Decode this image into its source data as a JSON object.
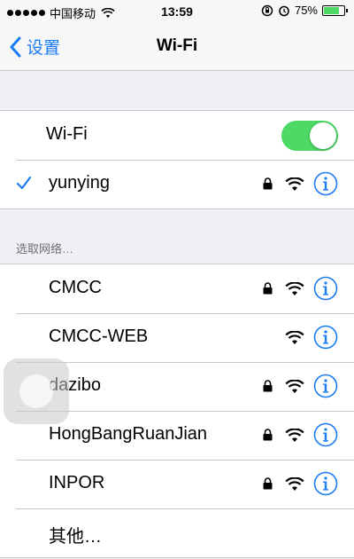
{
  "status_bar": {
    "carrier": "中国移动",
    "time": "13:59",
    "battery_percent": "75%",
    "battery_level": 0.75
  },
  "nav": {
    "back_label": "设置",
    "title": "Wi-Fi"
  },
  "wifi_toggle": {
    "label": "Wi-Fi",
    "on": true
  },
  "connected_network": {
    "name": "yunying",
    "locked": true
  },
  "section_header": "选取网络…",
  "networks": [
    {
      "name": "CMCC",
      "locked": true
    },
    {
      "name": "CMCC-WEB",
      "locked": false
    },
    {
      "name": "dazibo",
      "locked": true
    },
    {
      "name": "HongBangRuanJian",
      "locked": true
    },
    {
      "name": "INPOR",
      "locked": true
    }
  ],
  "other_label": "其他…",
  "colors": {
    "accent": "#1a7cf5",
    "toggle_on": "#4cd964",
    "background": "#efeff4"
  },
  "icons": [
    "checkmark-icon",
    "lock-icon",
    "wifi-icon",
    "info-icon",
    "chevron-left-icon",
    "alarm-icon",
    "rotation-lock-icon"
  ]
}
